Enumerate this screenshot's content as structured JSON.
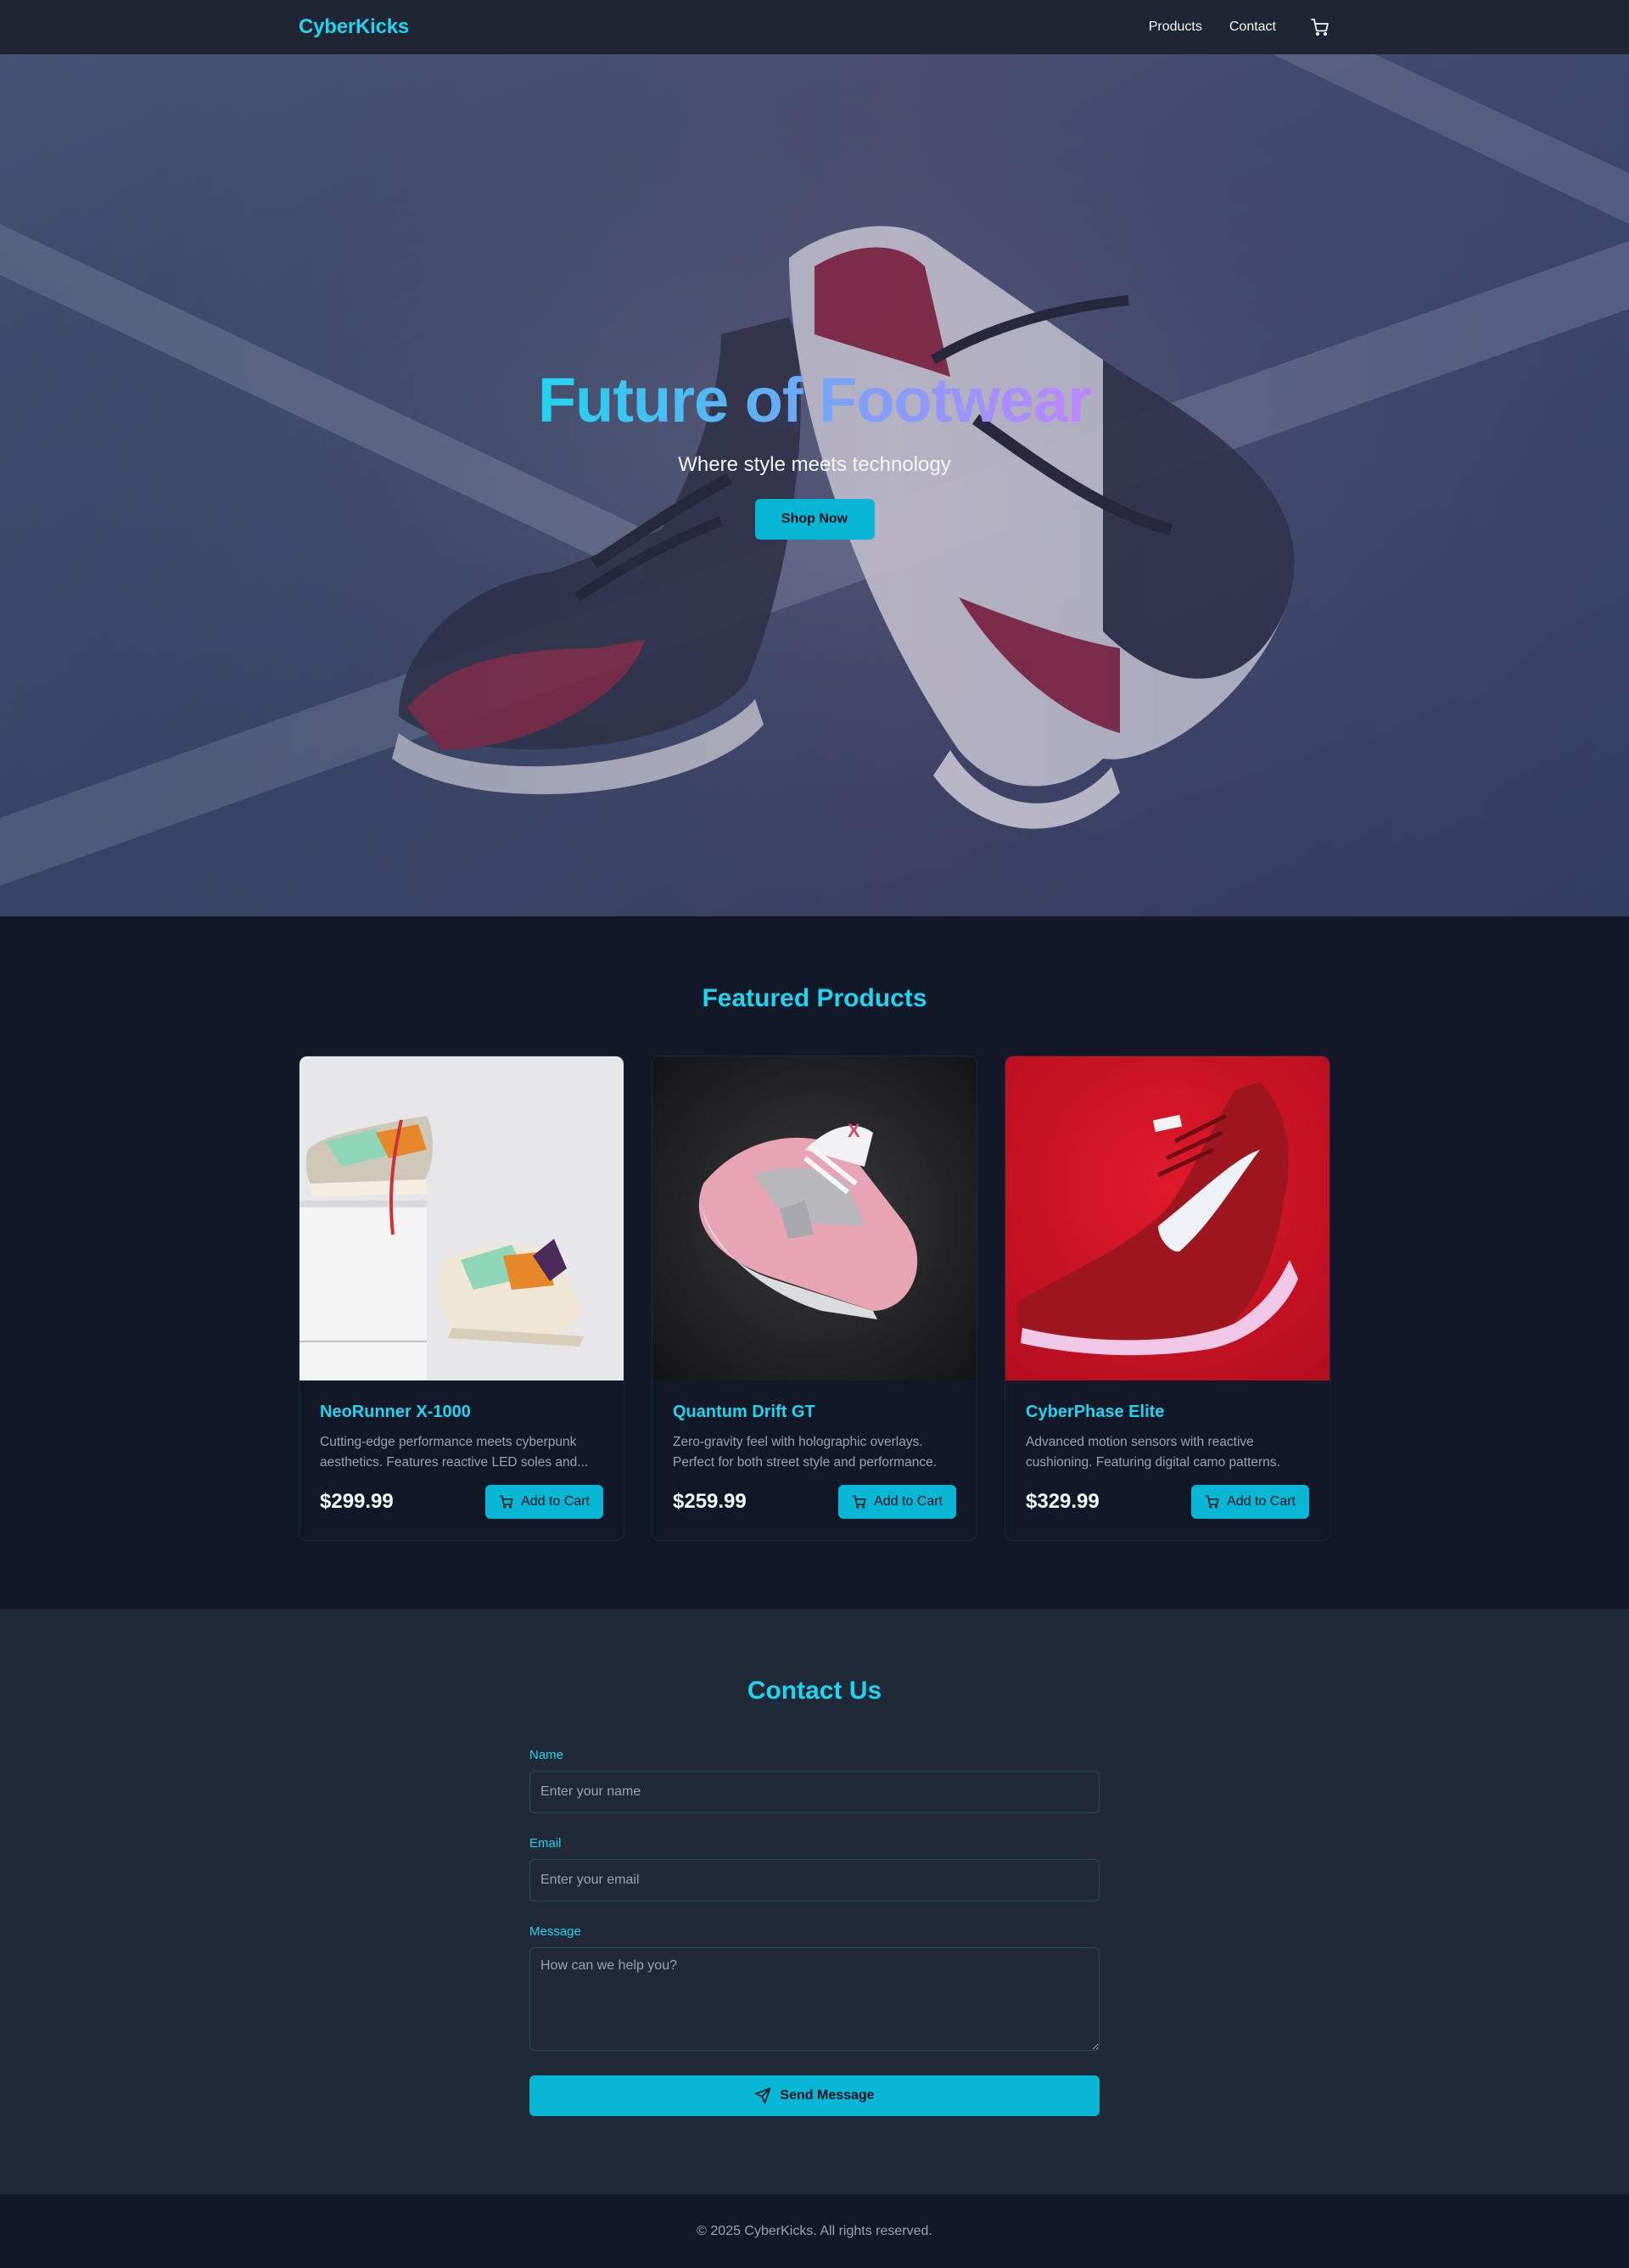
{
  "nav": {
    "brand": "CyberKicks",
    "links": [
      "Products",
      "Contact"
    ],
    "cart_icon": "cart-icon"
  },
  "hero": {
    "title": "Future of Footwear",
    "subtitle": "Where style meets technology",
    "cta": "Shop Now"
  },
  "featured": {
    "title": "Featured Products",
    "products": [
      {
        "name": "NeoRunner X-1000",
        "description": "Cutting-edge performance meets cyberpunk aesthetics. Features reactive LED soles and...",
        "price": "$299.99",
        "button": "Add to Cart"
      },
      {
        "name": "Quantum Drift GT",
        "description": "Zero-gravity feel with holographic overlays. Perfect for both street style and performance.",
        "price": "$259.99",
        "button": "Add to Cart"
      },
      {
        "name": "CyberPhase Elite",
        "description": "Advanced motion sensors with reactive cushioning. Featuring digital camo patterns.",
        "price": "$329.99",
        "button": "Add to Cart"
      }
    ]
  },
  "contact": {
    "title": "Contact Us",
    "name_label": "Name",
    "name_placeholder": "Enter your name",
    "email_label": "Email",
    "email_placeholder": "Enter your email",
    "message_label": "Message",
    "message_placeholder": "How can we help you?",
    "submit": "Send Message"
  },
  "footer": {
    "text": "© 2025 CyberKicks. All rights reserved."
  },
  "colors": {
    "accent": "#22d3ee",
    "button": "#06b6d4",
    "nav_bg": "#1e2533",
    "page_bg": "#111827",
    "contact_bg": "#1f2937"
  }
}
